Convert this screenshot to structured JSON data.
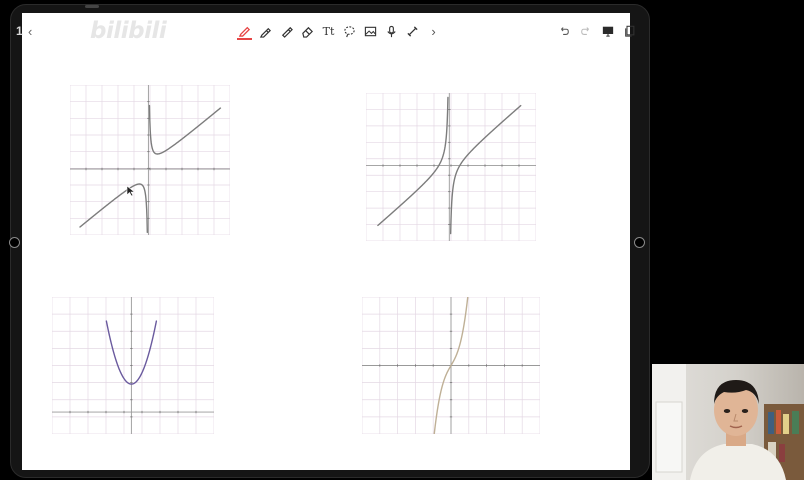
{
  "app": {
    "watermark": "bilibili",
    "watermark_left": "1",
    "back_label": "‹"
  },
  "toolbar": {
    "tools": [
      {
        "name": "pen-tool",
        "active": true
      },
      {
        "name": "highlighter-tool",
        "active": false
      },
      {
        "name": "marker-tool",
        "active": false
      },
      {
        "name": "eraser-tool",
        "active": false
      },
      {
        "name": "lasso-tool",
        "active": false
      },
      {
        "name": "text-tool",
        "active": false
      },
      {
        "name": "shape-tool",
        "active": false
      },
      {
        "name": "image-tool",
        "active": false
      },
      {
        "name": "microphone-tool",
        "active": false
      },
      {
        "name": "link-tool",
        "active": false
      }
    ],
    "text_tool_label": "Tt",
    "more_label": "›",
    "right_tools": [
      "undo-icon",
      "redo-icon",
      "present-icon",
      "pages-icon"
    ]
  },
  "colors": {
    "grid": "#e4d8e4",
    "axis": "#999999",
    "curve_gray": "#7c7c7c",
    "curve_purple": "#6a5a9e",
    "curve_tan": "#bfb096",
    "accent": "#e64545"
  },
  "graphs": [
    {
      "id": "graph-hyperbola",
      "curve": "x + 1/x",
      "color": "curve_gray"
    },
    {
      "id": "graph-x-minus-1-over-x",
      "curve": "x - 1/x",
      "color": "curve_gray"
    },
    {
      "id": "graph-parabola",
      "curve": "x^2 + c",
      "color": "curve_purple"
    },
    {
      "id": "graph-cubic",
      "curve": "x^3 + x",
      "color": "curve_tan"
    }
  ]
}
